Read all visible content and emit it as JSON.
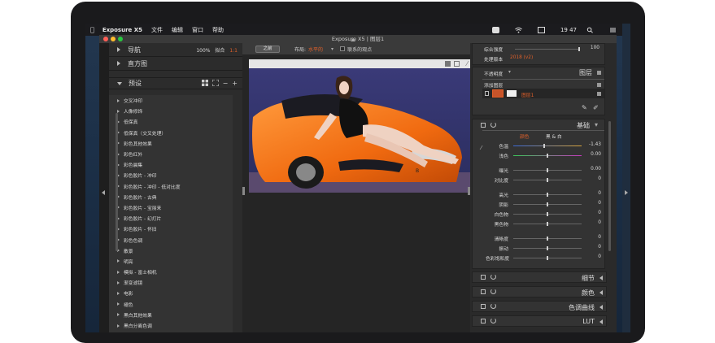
{
  "menubar": {
    "app_name": "Exposure X5",
    "items": [
      "文件",
      "编辑",
      "窗口",
      "帮助"
    ],
    "clock": "19 47"
  },
  "window": {
    "title": "Exposure X5 | 图层1"
  },
  "left_panel": {
    "navigator": "导航",
    "zoom": "100%",
    "fit": "拟合",
    "fit_ratio": "1:1",
    "histogram": "直方图",
    "presets_title": "预设",
    "presets": [
      "交叉冲印",
      "人像修饰",
      "低保真",
      "低保真（交叉处理）",
      "彩色其他效果",
      "彩色红外",
      "彩色晨集",
      "彩色胶片 - 冲印",
      "彩色胶片 - 冲印 - 低对比度",
      "彩色胶片 - 古典",
      "彩色胶片 - 宝丽来",
      "彩色胶片 - 幻灯片",
      "彩色胶片 - 怀旧",
      "彩色色调",
      "散景",
      "明亮",
      "模拟 - 富士相机",
      "渐变滤镜",
      "电影",
      "褪色",
      "黑白其他效果",
      "黑白分离色调"
    ]
  },
  "toolbar": {
    "before_btn": "之前",
    "layout_label": "布局:",
    "layout_value": "水平的",
    "link_label": "联系的观点"
  },
  "right_panel": {
    "overall_strength": "综合强度",
    "overall_strength_value": "100",
    "process_version": "处理版本",
    "process_version_value": "2018 (v2)",
    "opacity": "不透明度",
    "layers": "图层",
    "add_layer": "添加图层",
    "layer_name": "图层1",
    "basic": "基础",
    "tab_color": "颜色",
    "tab_bw": "黑 & 白",
    "sliders": [
      {
        "label": "色温",
        "value": "-1.43",
        "pos": 0.45
      },
      {
        "label": "浅色",
        "value": "0.00",
        "pos": 0.5
      },
      {
        "label": "曝光",
        "value": "0.00",
        "pos": 0.5
      },
      {
        "label": "对比度",
        "value": "0",
        "pos": 0.5
      },
      {
        "label": "高光",
        "value": "0",
        "pos": 0.5
      },
      {
        "label": "阴影",
        "value": "0",
        "pos": 0.5
      },
      {
        "label": "白色物",
        "value": "0",
        "pos": 0.5
      },
      {
        "label": "黑色物",
        "value": "0",
        "pos": 0.5
      },
      {
        "label": "清晰度",
        "value": "0",
        "pos": 0.5
      },
      {
        "label": "振动",
        "value": "0",
        "pos": 0.5
      },
      {
        "label": "色彩饱和度",
        "value": "0",
        "pos": 0.5
      }
    ],
    "sections": [
      "细节",
      "颜色",
      "色调曲线",
      "LUT"
    ]
  },
  "colors": {
    "accent": "#e0602a",
    "panel": "#333333",
    "window": "#2b2b2b"
  }
}
